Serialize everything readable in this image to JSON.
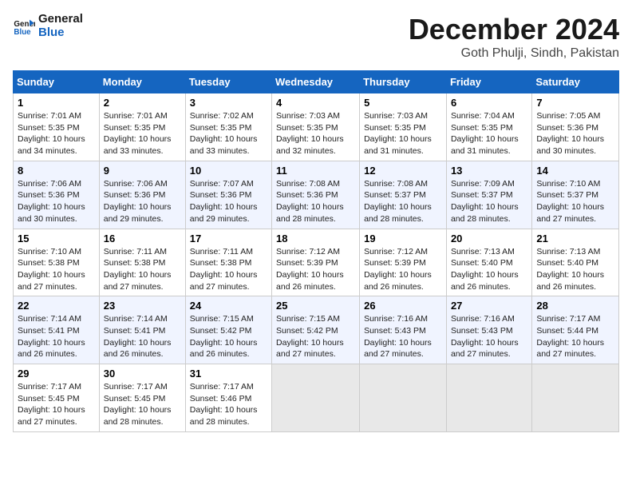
{
  "logo": {
    "line1": "General",
    "line2": "Blue"
  },
  "title": "December 2024",
  "location": "Goth Phulji, Sindh, Pakistan",
  "weekdays": [
    "Sunday",
    "Monday",
    "Tuesday",
    "Wednesday",
    "Thursday",
    "Friday",
    "Saturday"
  ],
  "weeks": [
    [
      {
        "day": "1",
        "sunrise": "7:01 AM",
        "sunset": "5:35 PM",
        "daylight": "10 hours and 34 minutes."
      },
      {
        "day": "2",
        "sunrise": "7:01 AM",
        "sunset": "5:35 PM",
        "daylight": "10 hours and 33 minutes."
      },
      {
        "day": "3",
        "sunrise": "7:02 AM",
        "sunset": "5:35 PM",
        "daylight": "10 hours and 33 minutes."
      },
      {
        "day": "4",
        "sunrise": "7:03 AM",
        "sunset": "5:35 PM",
        "daylight": "10 hours and 32 minutes."
      },
      {
        "day": "5",
        "sunrise": "7:03 AM",
        "sunset": "5:35 PM",
        "daylight": "10 hours and 31 minutes."
      },
      {
        "day": "6",
        "sunrise": "7:04 AM",
        "sunset": "5:35 PM",
        "daylight": "10 hours and 31 minutes."
      },
      {
        "day": "7",
        "sunrise": "7:05 AM",
        "sunset": "5:36 PM",
        "daylight": "10 hours and 30 minutes."
      }
    ],
    [
      {
        "day": "8",
        "sunrise": "7:06 AM",
        "sunset": "5:36 PM",
        "daylight": "10 hours and 30 minutes."
      },
      {
        "day": "9",
        "sunrise": "7:06 AM",
        "sunset": "5:36 PM",
        "daylight": "10 hours and 29 minutes."
      },
      {
        "day": "10",
        "sunrise": "7:07 AM",
        "sunset": "5:36 PM",
        "daylight": "10 hours and 29 minutes."
      },
      {
        "day": "11",
        "sunrise": "7:08 AM",
        "sunset": "5:36 PM",
        "daylight": "10 hours and 28 minutes."
      },
      {
        "day": "12",
        "sunrise": "7:08 AM",
        "sunset": "5:37 PM",
        "daylight": "10 hours and 28 minutes."
      },
      {
        "day": "13",
        "sunrise": "7:09 AM",
        "sunset": "5:37 PM",
        "daylight": "10 hours and 28 minutes."
      },
      {
        "day": "14",
        "sunrise": "7:10 AM",
        "sunset": "5:37 PM",
        "daylight": "10 hours and 27 minutes."
      }
    ],
    [
      {
        "day": "15",
        "sunrise": "7:10 AM",
        "sunset": "5:38 PM",
        "daylight": "10 hours and 27 minutes."
      },
      {
        "day": "16",
        "sunrise": "7:11 AM",
        "sunset": "5:38 PM",
        "daylight": "10 hours and 27 minutes."
      },
      {
        "day": "17",
        "sunrise": "7:11 AM",
        "sunset": "5:38 PM",
        "daylight": "10 hours and 27 minutes."
      },
      {
        "day": "18",
        "sunrise": "7:12 AM",
        "sunset": "5:39 PM",
        "daylight": "10 hours and 26 minutes."
      },
      {
        "day": "19",
        "sunrise": "7:12 AM",
        "sunset": "5:39 PM",
        "daylight": "10 hours and 26 minutes."
      },
      {
        "day": "20",
        "sunrise": "7:13 AM",
        "sunset": "5:40 PM",
        "daylight": "10 hours and 26 minutes."
      },
      {
        "day": "21",
        "sunrise": "7:13 AM",
        "sunset": "5:40 PM",
        "daylight": "10 hours and 26 minutes."
      }
    ],
    [
      {
        "day": "22",
        "sunrise": "7:14 AM",
        "sunset": "5:41 PM",
        "daylight": "10 hours and 26 minutes."
      },
      {
        "day": "23",
        "sunrise": "7:14 AM",
        "sunset": "5:41 PM",
        "daylight": "10 hours and 26 minutes."
      },
      {
        "day": "24",
        "sunrise": "7:15 AM",
        "sunset": "5:42 PM",
        "daylight": "10 hours and 26 minutes."
      },
      {
        "day": "25",
        "sunrise": "7:15 AM",
        "sunset": "5:42 PM",
        "daylight": "10 hours and 27 minutes."
      },
      {
        "day": "26",
        "sunrise": "7:16 AM",
        "sunset": "5:43 PM",
        "daylight": "10 hours and 27 minutes."
      },
      {
        "day": "27",
        "sunrise": "7:16 AM",
        "sunset": "5:43 PM",
        "daylight": "10 hours and 27 minutes."
      },
      {
        "day": "28",
        "sunrise": "7:17 AM",
        "sunset": "5:44 PM",
        "daylight": "10 hours and 27 minutes."
      }
    ],
    [
      {
        "day": "29",
        "sunrise": "7:17 AM",
        "sunset": "5:45 PM",
        "daylight": "10 hours and 27 minutes."
      },
      {
        "day": "30",
        "sunrise": "7:17 AM",
        "sunset": "5:45 PM",
        "daylight": "10 hours and 28 minutes."
      },
      {
        "day": "31",
        "sunrise": "7:17 AM",
        "sunset": "5:46 PM",
        "daylight": "10 hours and 28 minutes."
      },
      null,
      null,
      null,
      null
    ]
  ],
  "labels": {
    "sunrise": "Sunrise:",
    "sunset": "Sunset:",
    "daylight": "Daylight:"
  }
}
